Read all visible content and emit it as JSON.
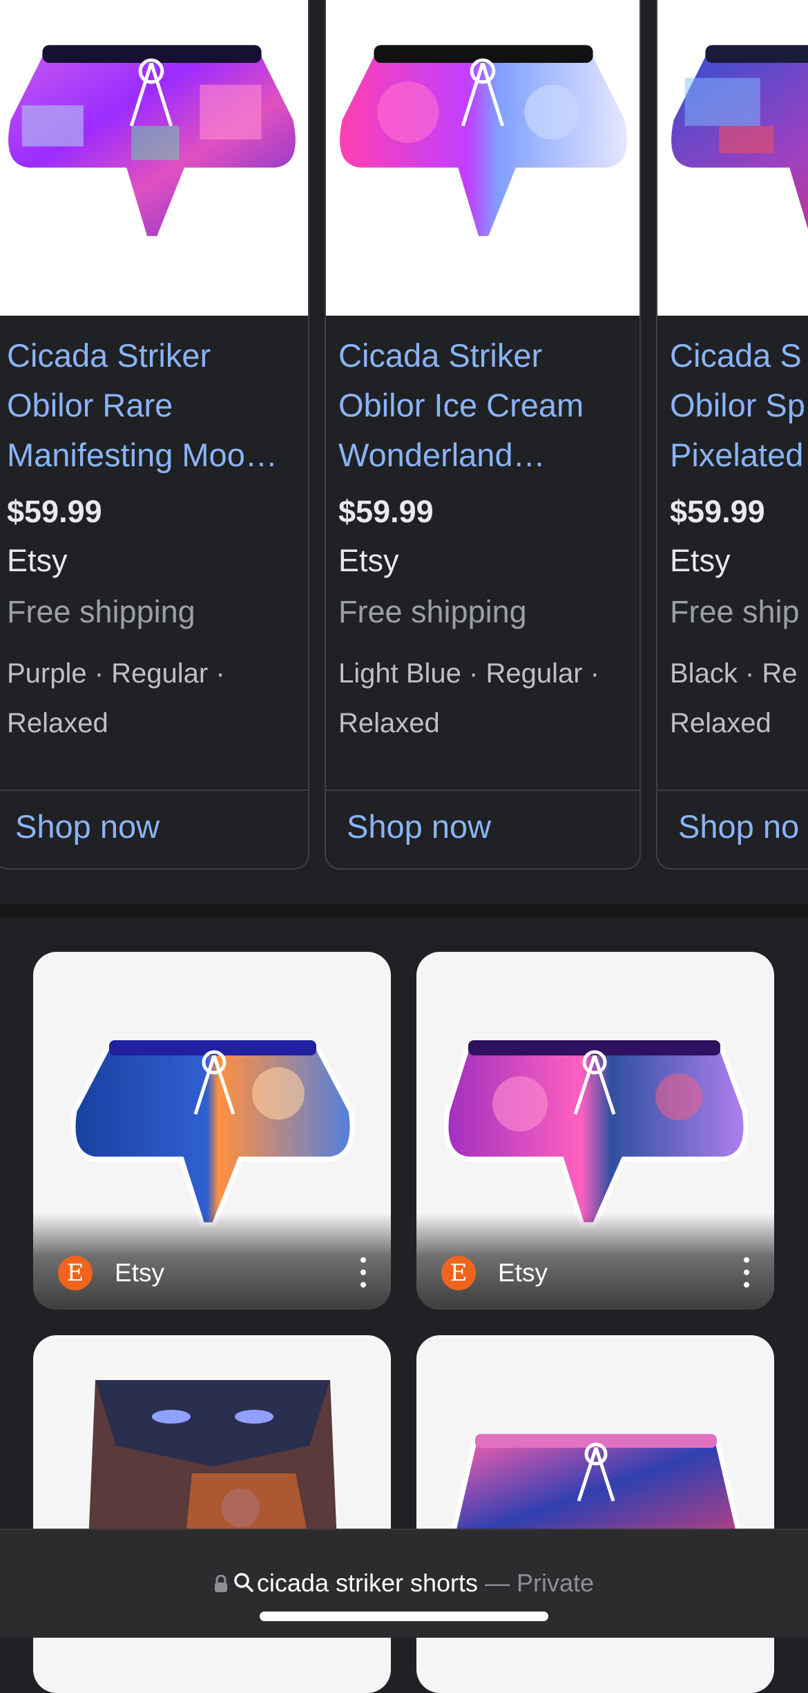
{
  "carousel": {
    "cards": [
      {
        "title": "Cicada Striker\nObilor Rare\nManifesting Moo…",
        "price": "$59.99",
        "merchant": "Etsy",
        "shipping": "Free shipping",
        "attributes": "Purple · Regular ·\nRelaxed",
        "cta": "Shop now"
      },
      {
        "title": "Cicada Striker\nObilor Ice Cream\nWonderland…",
        "price": "$59.99",
        "merchant": "Etsy",
        "shipping": "Free shipping",
        "attributes": "Light Blue · Regular ·\nRelaxed",
        "cta": "Shop now"
      },
      {
        "title": "Cicada S\nObilor Sp\nPixelated",
        "price": "$59.99",
        "merchant": "Etsy",
        "shipping": "Free ship",
        "attributes": "Black · Re\nRelaxed",
        "cta": "Shop no"
      }
    ]
  },
  "image_grid": {
    "tiles": [
      {
        "source": "Etsy",
        "favicon_letter": "E"
      },
      {
        "source": "Etsy",
        "favicon_letter": "E"
      },
      {
        "source": ""
      },
      {
        "source": ""
      }
    ]
  },
  "address_bar": {
    "query": "cicada striker shorts",
    "mode": "— Private"
  },
  "colors": {
    "background": "#202124",
    "link_blue": "#8ab4f8",
    "etsy_orange": "#f1641e"
  }
}
